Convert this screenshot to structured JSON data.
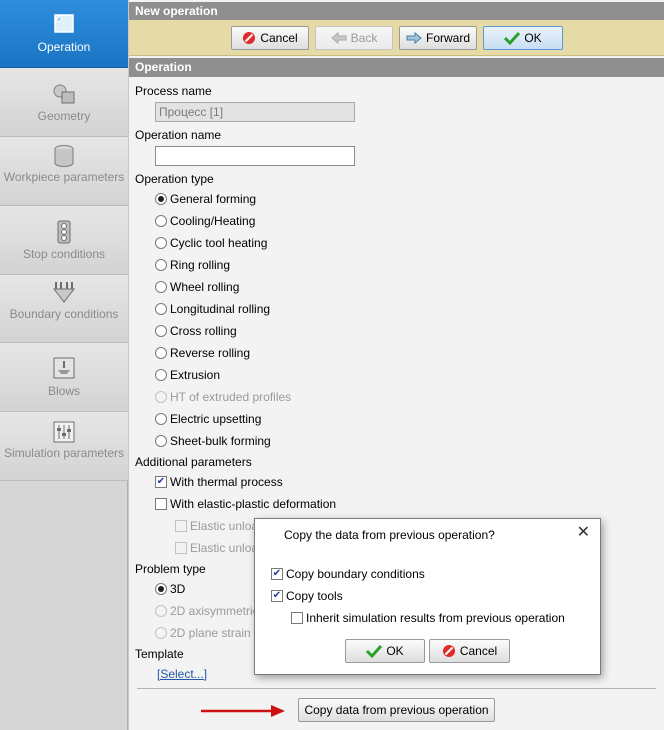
{
  "sidebar": {
    "items": [
      {
        "label": "Operation",
        "icon": "operation-icon",
        "active": true
      },
      {
        "label": "Geometry",
        "icon": "geometry-icon",
        "active": false
      },
      {
        "label": "Workpiece parameters",
        "icon": "workpiece-icon",
        "active": false
      },
      {
        "label": "Stop conditions",
        "icon": "traffic-light-icon",
        "active": false
      },
      {
        "label": "Boundary conditions",
        "icon": "boundary-icon",
        "active": false
      },
      {
        "label": "Blows",
        "icon": "blows-icon",
        "active": false
      },
      {
        "label": "Simulation parameters",
        "icon": "sliders-icon",
        "active": false
      }
    ]
  },
  "header": {
    "title": "New operation",
    "section": "Operation"
  },
  "toolbar": {
    "cancel": "Cancel",
    "back": "Back",
    "forward": "Forward",
    "ok": "OK"
  },
  "form": {
    "process_name_label": "Process name",
    "process_name_value": "Процесс [1]",
    "operation_name_label": "Operation name",
    "operation_name_value": "",
    "operation_type_label": "Operation type",
    "operation_types": [
      {
        "label": "General forming",
        "checked": true,
        "disabled": false
      },
      {
        "label": "Cooling/Heating",
        "checked": false,
        "disabled": false
      },
      {
        "label": "Cyclic tool heating",
        "checked": false,
        "disabled": false
      },
      {
        "label": "Ring rolling",
        "checked": false,
        "disabled": false
      },
      {
        "label": "Wheel rolling",
        "checked": false,
        "disabled": false
      },
      {
        "label": "Longitudinal rolling",
        "checked": false,
        "disabled": false
      },
      {
        "label": "Cross rolling",
        "checked": false,
        "disabled": false
      },
      {
        "label": "Reverse rolling",
        "checked": false,
        "disabled": false
      },
      {
        "label": "Extrusion",
        "checked": false,
        "disabled": false
      },
      {
        "label": "HT of extruded profiles",
        "checked": false,
        "disabled": true
      },
      {
        "label": "Electric upsetting",
        "checked": false,
        "disabled": false
      },
      {
        "label": "Sheet-bulk forming",
        "checked": false,
        "disabled": false
      }
    ],
    "additional_label": "Additional parameters",
    "thermal_label": "With thermal process",
    "thermal_checked": true,
    "elastic_label": "With elastic-plastic deformation",
    "elastic_checked": false,
    "elastic_sub1": "Elastic unloa",
    "elastic_sub2": "Elastic unloa",
    "problem_type_label": "Problem type",
    "problem_types": [
      {
        "label": "3D",
        "checked": true,
        "disabled": false
      },
      {
        "label": "2D axisymmetric",
        "checked": false,
        "disabled": true
      },
      {
        "label": "2D plane strain",
        "checked": false,
        "disabled": true
      }
    ],
    "template_label": "Template",
    "template_link": "[Select...]"
  },
  "footer": {
    "copy_button": "Copy data from previous operation"
  },
  "dialog": {
    "title": "Copy the data from previous operation?",
    "close": "✕",
    "copy_boundary": "Copy boundary conditions",
    "copy_boundary_checked": true,
    "copy_tools": "Copy tools",
    "copy_tools_checked": true,
    "inherit": "Inherit simulation results from previous operation",
    "inherit_checked": false,
    "ok": "OK",
    "cancel": "Cancel"
  },
  "colors": {
    "accent": "#1b73c4",
    "toolbar": "#e6dba6",
    "header": "#8f8f8f",
    "arrow": "#cc1111"
  }
}
